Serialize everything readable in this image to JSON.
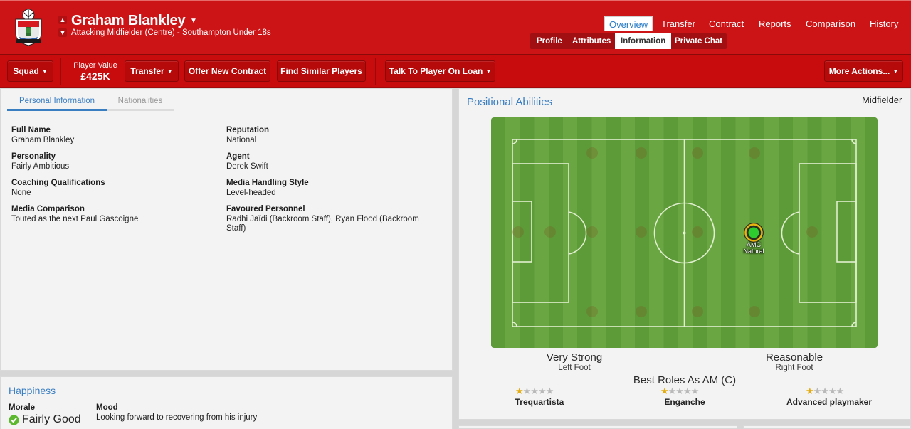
{
  "header": {
    "player_name": "Graham Blankley",
    "subtitle": "Attacking Midfielder (Centre) - Southampton Under 18s",
    "main_tabs": [
      "Overview",
      "Transfer",
      "Contract",
      "Reports",
      "Comparison",
      "History"
    ],
    "active_main_tab": "Overview",
    "sub_tabs": [
      "Profile",
      "Attributes",
      "Information",
      "Private Chat"
    ],
    "active_sub_tab": "Information"
  },
  "toolbar": {
    "squad": "Squad",
    "player_value_label": "Player Value",
    "player_value": "£425K",
    "transfer": "Transfer",
    "offer_contract": "Offer New Contract",
    "find_similar": "Find Similar Players",
    "talk_loan": "Talk To Player On Loan",
    "more_actions": "More Actions..."
  },
  "personal": {
    "tabs": [
      "Personal Information",
      "Nationalities"
    ],
    "fields": [
      {
        "label": "Full Name",
        "value": "Graham Blankley"
      },
      {
        "label": "Reputation",
        "value": "National"
      },
      {
        "label": "Personality",
        "value": "Fairly Ambitious"
      },
      {
        "label": "Agent",
        "value": "Derek Swift"
      },
      {
        "label": "Coaching Qualifications",
        "value": "None"
      },
      {
        "label": "Media Handling Style",
        "value": "Level-headed"
      },
      {
        "label": "Media Comparison",
        "value": "Touted as the next Paul Gascoigne"
      },
      {
        "label": "Favoured Personnel",
        "value": "Radhi Jaïdi (Backroom Staff), Ryan Flood (Backroom Staff)"
      }
    ]
  },
  "happiness": {
    "title": "Happiness",
    "morale_label": "Morale",
    "morale_value": "Fairly Good",
    "mood_label": "Mood",
    "mood_value": "Looking forward to recovering from his injury"
  },
  "positional": {
    "title": "Positional Abilities",
    "position_summary": "Midfielder",
    "marker_position": "AMC",
    "marker_rating": "Natural",
    "left_foot_rating": "Very Strong",
    "left_foot_label": "Left Foot",
    "right_foot_rating": "Reasonable",
    "right_foot_label": "Right Foot",
    "best_roles_title": "Best Roles As AM (C)",
    "roles": [
      {
        "name": "Trequartista",
        "stars": 1
      },
      {
        "name": "Enganche",
        "stars": 1
      },
      {
        "name": "Advanced playmaker",
        "stars": 1
      }
    ],
    "max_stars": 5
  },
  "colors": {
    "header_red": "#cc1417",
    "toolbar_red": "#c80c0d",
    "accent_blue": "#3a7ec2",
    "pitch_green": "#5d9a38",
    "natural_green": "#2ecc2e",
    "star_gold": "#e3ad12"
  },
  "icons": {
    "crest": "southampton-crest-icon",
    "morale": "morale-check-icon",
    "dropdown": "caret-down-icon"
  }
}
